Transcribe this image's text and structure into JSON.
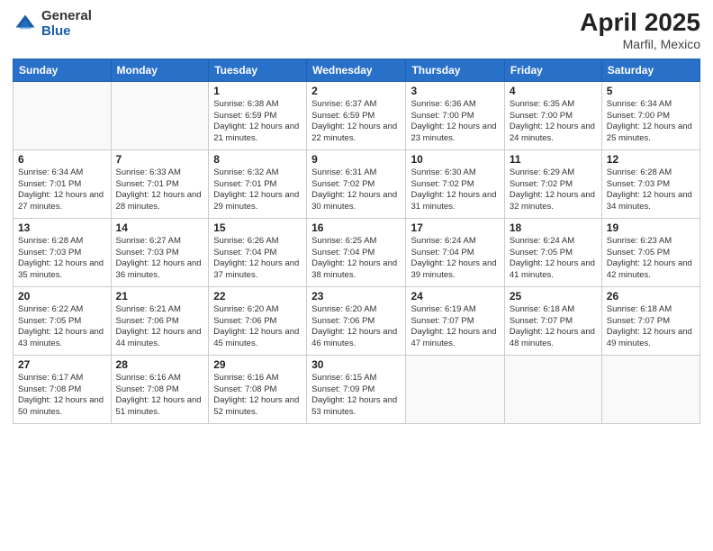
{
  "logo": {
    "general": "General",
    "blue": "Blue"
  },
  "title": {
    "month": "April 2025",
    "location": "Marfil, Mexico"
  },
  "headers": [
    "Sunday",
    "Monday",
    "Tuesday",
    "Wednesday",
    "Thursday",
    "Friday",
    "Saturday"
  ],
  "weeks": [
    [
      {
        "day": "",
        "detail": ""
      },
      {
        "day": "",
        "detail": ""
      },
      {
        "day": "1",
        "detail": "Sunrise: 6:38 AM\nSunset: 6:59 PM\nDaylight: 12 hours\nand 21 minutes."
      },
      {
        "day": "2",
        "detail": "Sunrise: 6:37 AM\nSunset: 6:59 PM\nDaylight: 12 hours\nand 22 minutes."
      },
      {
        "day": "3",
        "detail": "Sunrise: 6:36 AM\nSunset: 7:00 PM\nDaylight: 12 hours\nand 23 minutes."
      },
      {
        "day": "4",
        "detail": "Sunrise: 6:35 AM\nSunset: 7:00 PM\nDaylight: 12 hours\nand 24 minutes."
      },
      {
        "day": "5",
        "detail": "Sunrise: 6:34 AM\nSunset: 7:00 PM\nDaylight: 12 hours\nand 25 minutes."
      }
    ],
    [
      {
        "day": "6",
        "detail": "Sunrise: 6:34 AM\nSunset: 7:01 PM\nDaylight: 12 hours\nand 27 minutes."
      },
      {
        "day": "7",
        "detail": "Sunrise: 6:33 AM\nSunset: 7:01 PM\nDaylight: 12 hours\nand 28 minutes."
      },
      {
        "day": "8",
        "detail": "Sunrise: 6:32 AM\nSunset: 7:01 PM\nDaylight: 12 hours\nand 29 minutes."
      },
      {
        "day": "9",
        "detail": "Sunrise: 6:31 AM\nSunset: 7:02 PM\nDaylight: 12 hours\nand 30 minutes."
      },
      {
        "day": "10",
        "detail": "Sunrise: 6:30 AM\nSunset: 7:02 PM\nDaylight: 12 hours\nand 31 minutes."
      },
      {
        "day": "11",
        "detail": "Sunrise: 6:29 AM\nSunset: 7:02 PM\nDaylight: 12 hours\nand 32 minutes."
      },
      {
        "day": "12",
        "detail": "Sunrise: 6:28 AM\nSunset: 7:03 PM\nDaylight: 12 hours\nand 34 minutes."
      }
    ],
    [
      {
        "day": "13",
        "detail": "Sunrise: 6:28 AM\nSunset: 7:03 PM\nDaylight: 12 hours\nand 35 minutes."
      },
      {
        "day": "14",
        "detail": "Sunrise: 6:27 AM\nSunset: 7:03 PM\nDaylight: 12 hours\nand 36 minutes."
      },
      {
        "day": "15",
        "detail": "Sunrise: 6:26 AM\nSunset: 7:04 PM\nDaylight: 12 hours\nand 37 minutes."
      },
      {
        "day": "16",
        "detail": "Sunrise: 6:25 AM\nSunset: 7:04 PM\nDaylight: 12 hours\nand 38 minutes."
      },
      {
        "day": "17",
        "detail": "Sunrise: 6:24 AM\nSunset: 7:04 PM\nDaylight: 12 hours\nand 39 minutes."
      },
      {
        "day": "18",
        "detail": "Sunrise: 6:24 AM\nSunset: 7:05 PM\nDaylight: 12 hours\nand 41 minutes."
      },
      {
        "day": "19",
        "detail": "Sunrise: 6:23 AM\nSunset: 7:05 PM\nDaylight: 12 hours\nand 42 minutes."
      }
    ],
    [
      {
        "day": "20",
        "detail": "Sunrise: 6:22 AM\nSunset: 7:05 PM\nDaylight: 12 hours\nand 43 minutes."
      },
      {
        "day": "21",
        "detail": "Sunrise: 6:21 AM\nSunset: 7:06 PM\nDaylight: 12 hours\nand 44 minutes."
      },
      {
        "day": "22",
        "detail": "Sunrise: 6:20 AM\nSunset: 7:06 PM\nDaylight: 12 hours\nand 45 minutes."
      },
      {
        "day": "23",
        "detail": "Sunrise: 6:20 AM\nSunset: 7:06 PM\nDaylight: 12 hours\nand 46 minutes."
      },
      {
        "day": "24",
        "detail": "Sunrise: 6:19 AM\nSunset: 7:07 PM\nDaylight: 12 hours\nand 47 minutes."
      },
      {
        "day": "25",
        "detail": "Sunrise: 6:18 AM\nSunset: 7:07 PM\nDaylight: 12 hours\nand 48 minutes."
      },
      {
        "day": "26",
        "detail": "Sunrise: 6:18 AM\nSunset: 7:07 PM\nDaylight: 12 hours\nand 49 minutes."
      }
    ],
    [
      {
        "day": "27",
        "detail": "Sunrise: 6:17 AM\nSunset: 7:08 PM\nDaylight: 12 hours\nand 50 minutes."
      },
      {
        "day": "28",
        "detail": "Sunrise: 6:16 AM\nSunset: 7:08 PM\nDaylight: 12 hours\nand 51 minutes."
      },
      {
        "day": "29",
        "detail": "Sunrise: 6:16 AM\nSunset: 7:08 PM\nDaylight: 12 hours\nand 52 minutes."
      },
      {
        "day": "30",
        "detail": "Sunrise: 6:15 AM\nSunset: 7:09 PM\nDaylight: 12 hours\nand 53 minutes."
      },
      {
        "day": "",
        "detail": ""
      },
      {
        "day": "",
        "detail": ""
      },
      {
        "day": "",
        "detail": ""
      }
    ]
  ]
}
